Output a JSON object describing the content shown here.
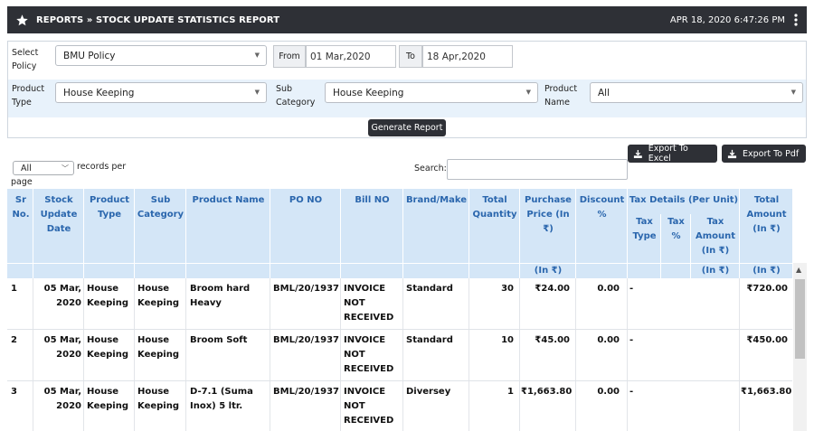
{
  "header": {
    "title": "REPORTS » STOCK UPDATE STATISTICS REPORT",
    "datetime": "APR 18, 2020  6:47:26 PM",
    "star_icon": "star-icon",
    "menu_icon": "kebab-menu-icon"
  },
  "filters": {
    "policy_label": "Select Policy",
    "policy_value": "BMU Policy",
    "from_label": "From",
    "from_value": "01 Mar,2020",
    "to_label": "To",
    "to_value": "18 Apr,2020",
    "product_type_label": "Product Type",
    "product_type_value": "House Keeping",
    "sub_category_label": "Sub Category",
    "sub_category_value": "House Keeping",
    "product_name_label": "Product Name",
    "product_name_value": "All",
    "generate_button": "Generate Report"
  },
  "toolbar": {
    "export_excel": "Export To Excel",
    "export_pdf": "Export To Pdf",
    "per_page_value": "All",
    "records_per": "records per",
    "page": "page",
    "search_label": "Search:"
  },
  "table": {
    "headers": {
      "sr": "Sr No.",
      "date": "Stock Update Date",
      "ptype": "Product Type",
      "subcat": "Sub Category",
      "pname": "Product Name",
      "pono": "PO NO",
      "billno": "Bill NO",
      "brand": "Brand/Make",
      "qty": "Total Quantity",
      "price": "Purchase Price (In ₹)",
      "discount": "Discount %",
      "tax_group": "Tax Details (Per Unit)",
      "tax_type": "Tax Type",
      "tax_pct": "Tax %",
      "tax_amount": "Tax Amount (In ₹)",
      "total": "Total Amount (In ₹)"
    },
    "subheader": {
      "price_unit": "(In ₹)",
      "tax_unit": "(In ₹)",
      "total_unit": "(In ₹)"
    },
    "rows": [
      {
        "sr": "1",
        "date": "05 Mar, 2020",
        "ptype": "House Keeping",
        "subcat": "House Keeping",
        "pname": "Broom hard Heavy",
        "pono": "BML/20/1937",
        "billno": "INVOICE NOT RECEIVED",
        "brand": "Standard",
        "qty": "30",
        "price": "₹24.00",
        "discount": "0.00",
        "tax": "-",
        "total": "₹720.00"
      },
      {
        "sr": "2",
        "date": "05 Mar, 2020",
        "ptype": "House Keeping",
        "subcat": "House Keeping",
        "pname": "Broom Soft",
        "pono": "BML/20/1937",
        "billno": "INVOICE NOT RECEIVED",
        "brand": "Standard",
        "qty": "10",
        "price": "₹45.00",
        "discount": "0.00",
        "tax": "-",
        "total": "₹450.00"
      },
      {
        "sr": "3",
        "date": "05 Mar, 2020",
        "ptype": "House Keeping",
        "subcat": "House Keeping",
        "pname": "D-7.1 (Suma Inox) 5 ltr.",
        "pono": "BML/20/1937",
        "billno": "INVOICE NOT RECEIVED",
        "brand": "Diversey",
        "qty": "1",
        "price": "₹1,663.80",
        "discount": "0.00",
        "tax": "-",
        "total": "₹1,663.80"
      }
    ]
  }
}
